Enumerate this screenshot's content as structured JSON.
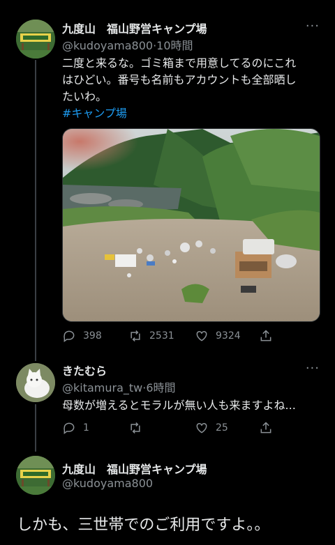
{
  "tweets": [
    {
      "display_name": "九度山　福山野営キャンプ場",
      "handle": "@kudoyama800",
      "time": "10時間",
      "text_lines": [
        "二度と来るな。ゴミ箱まで用意してるのにこれ",
        "はひどい。番号も名前もアカウントも全部晒し",
        "たいわ。"
      ],
      "hashtag": "#キャンプ場",
      "replies": "398",
      "retweets": "2531",
      "likes": "9324"
    },
    {
      "display_name": "きたむら",
      "handle": "@kitamura_tw",
      "time": "6時間",
      "text": "母数が増えるとモラルが無い人も来ますよね...",
      "replies": "1",
      "retweets": "",
      "likes": "25"
    },
    {
      "display_name": "九度山　福山野営キャンプ場",
      "handle": "@kudoyama800",
      "text": "しかも、三世帯でのご利用ですよ。。"
    }
  ],
  "meta_separator": "·",
  "more_glyph": "···",
  "colors": {
    "background": "#000000",
    "text": "#e7e9ea",
    "muted": "#8b9196",
    "link": "#1d9bf0"
  },
  "icons": [
    "reply-icon",
    "retweet-icon",
    "like-icon",
    "share-icon",
    "more-icon"
  ]
}
